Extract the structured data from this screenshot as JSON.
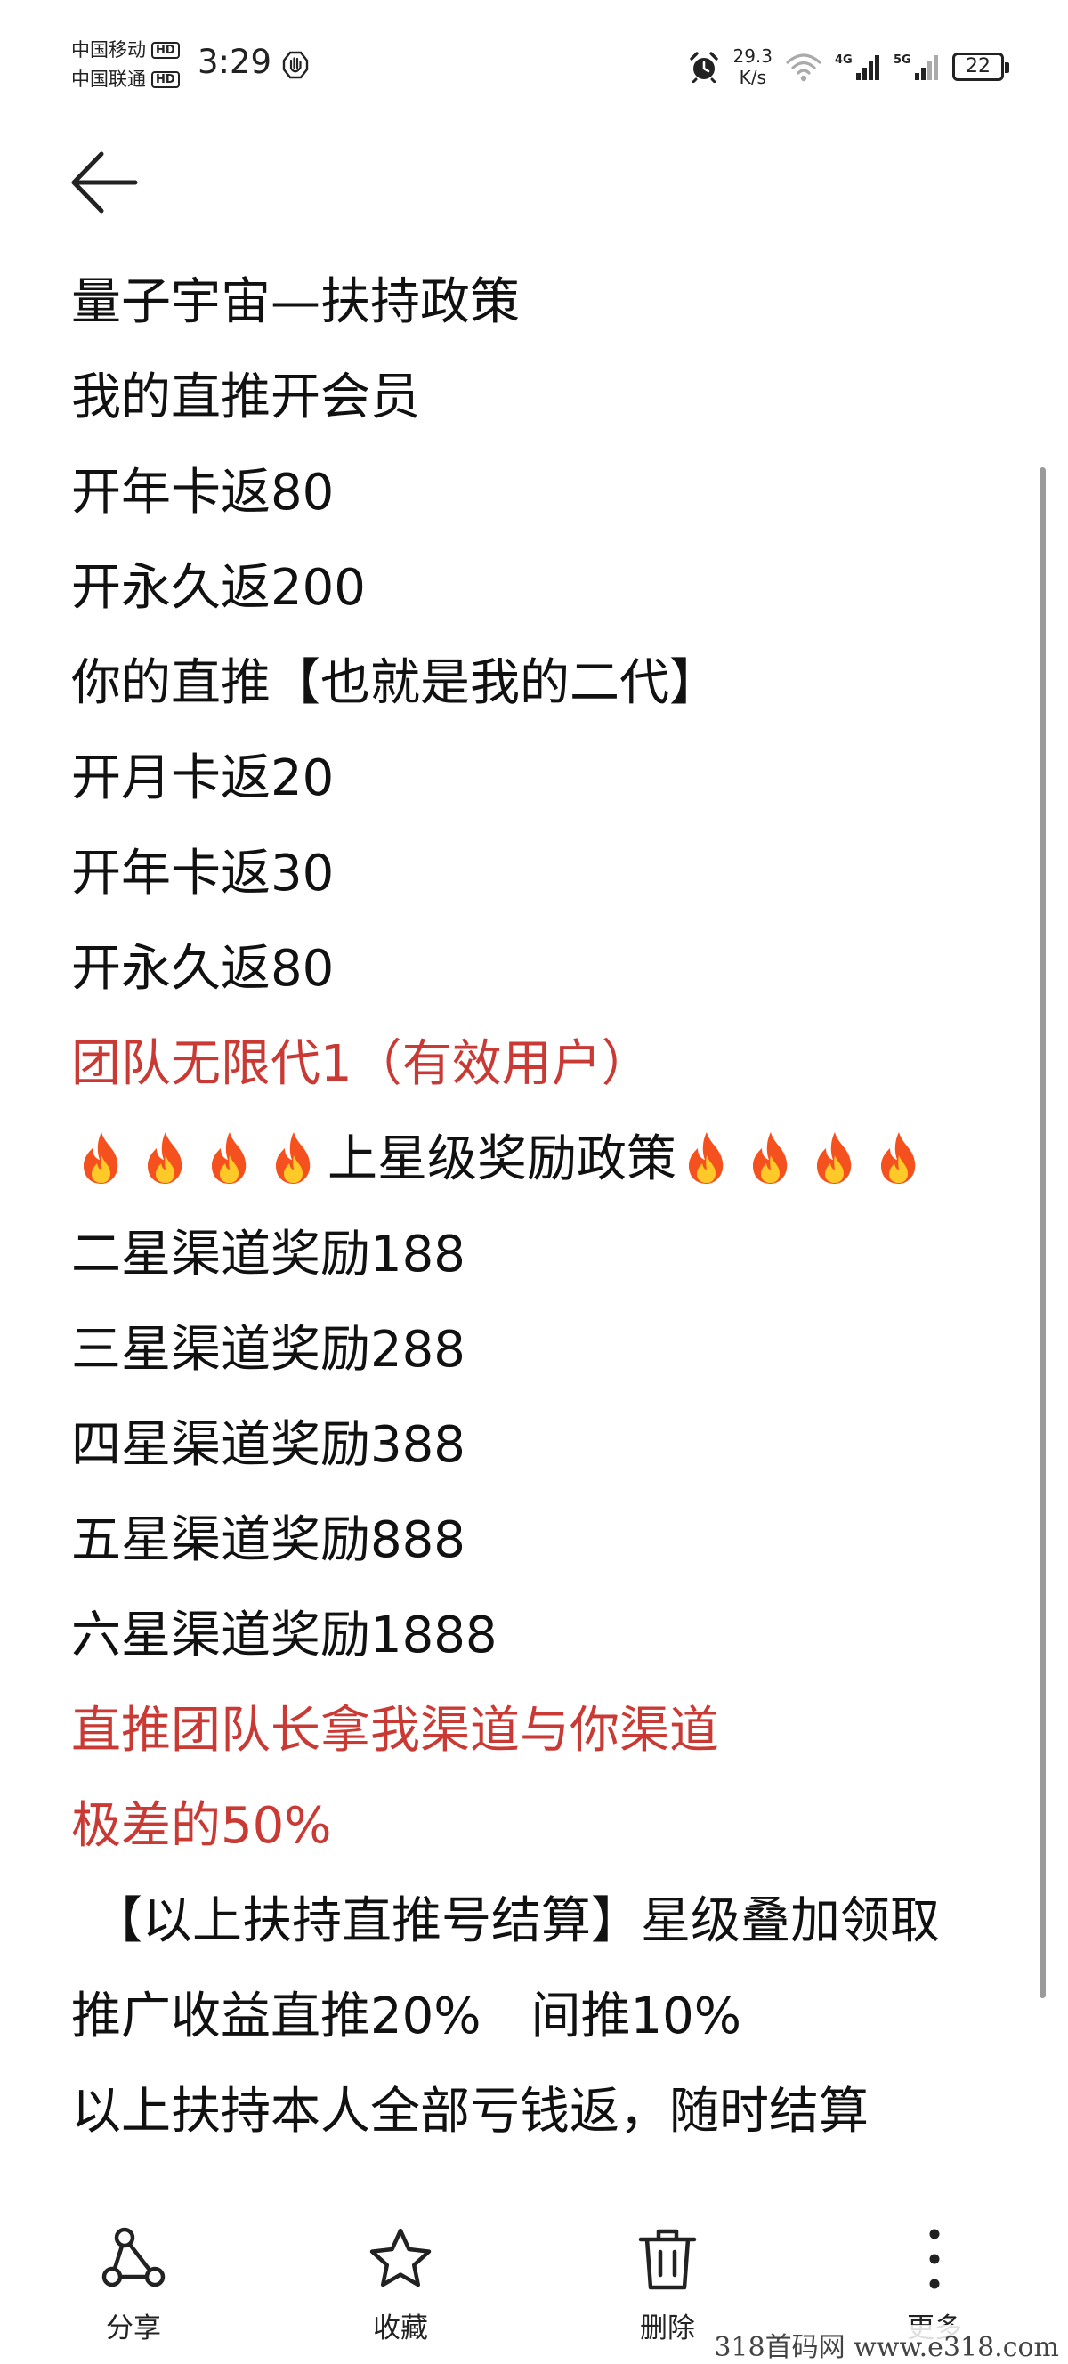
{
  "status_bar": {
    "carrier_1": "中国移动",
    "carrier_2": "中国联通",
    "hd_badge": "HD",
    "time": "3:29",
    "net_speed_value": "29.3",
    "net_speed_unit": "K/s",
    "signal_1_label": "4G",
    "signal_2_label": "5G",
    "battery": "22"
  },
  "note": {
    "lines": [
      "量子宇宙—扶持政策",
      "我的直推开会员",
      "开年卡返80",
      "开永久返200",
      "你的直推【也就是我的二代】",
      "开月卡返20",
      "开年卡返30",
      "开永久返80",
      "团队无限代1（有效用户）",
      "上星级奖励政策",
      "二星渠道奖励188",
      "三星渠道奖励288",
      "四星渠道奖励388",
      "五星渠道奖励888",
      "六星渠道奖励1888",
      "直推团队长拿我渠道与你渠道",
      "极差的50%",
      "【以上扶持直推号结算】星级叠加领取",
      "推广收益直推20%　间推10%",
      "以上扶持本人全部亏钱返，随时结算"
    ],
    "accent_color": "#c93a34"
  },
  "toolbar": {
    "share": "分享",
    "favorite": "收藏",
    "delete": "删除",
    "more": "更多"
  },
  "watermark": "318首码网 www.e318.com"
}
